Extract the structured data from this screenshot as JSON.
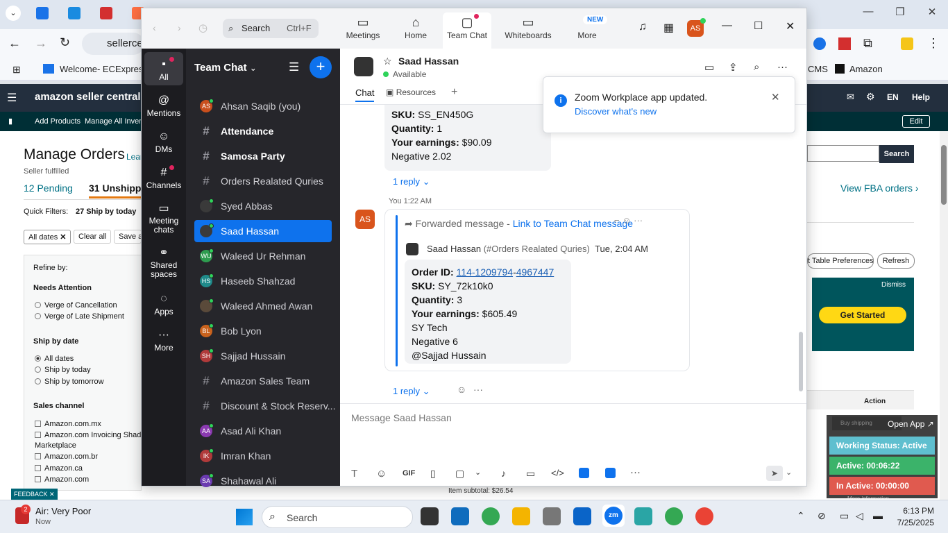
{
  "browser": {
    "tabs": [
      {
        "icon": "ec-icon"
      },
      {
        "icon": "doc-icon"
      },
      {
        "icon": "flag-icon"
      },
      {
        "icon": "swirl-icon"
      }
    ],
    "address": "sellerce",
    "bookmarks": [
      {
        "icon": "ec-icon",
        "label": "Welcome- ECExpres..."
      },
      {
        "label": "CMS"
      },
      {
        "icon": "amazon-icon",
        "label": "Amazon"
      }
    ]
  },
  "amazon": {
    "logo": "amazon seller central",
    "header_right": {
      "lang": "EN",
      "help": "Help"
    },
    "nav": {
      "add_products": "Add Products",
      "manage_inventory": "Manage All Invent",
      "edit": "Edit"
    },
    "page_title": "Manage Orders",
    "learn": "Lear",
    "seller_fulfilled": "Seller fulfilled",
    "pending": "12 Pending",
    "unshipped": "31 Unshipp",
    "quick_filters_label": "Quick Filters:",
    "quick_filter_value": "27 Ship by today",
    "all_dates": "All dates",
    "clear_all": "Clear all",
    "save": "Save a",
    "search_btn": "Search",
    "view_fba": "View FBA orders",
    "table_prefs": "t Table Preferences",
    "refresh": "Refresh",
    "refine_by": "Refine by:",
    "needs_attention": "Needs Attention",
    "attention_options": [
      "Verge of Cancellation",
      "Verge of Late Shipment"
    ],
    "ship_by_date": "Ship by date",
    "ship_options": [
      "All dates",
      "Ship by today",
      "Ship by tomorrow"
    ],
    "sales_channel": "Sales channel",
    "channels": [
      "Amazon.com.mx",
      "Amazon.com Invoicing Shado",
      "Marketplace",
      "Amazon.com.br",
      "Amazon.ca",
      "Amazon.com"
    ],
    "banner": {
      "dismiss": "Dismiss",
      "get_started": "Get Started"
    },
    "action_header": "Action",
    "item_subtotal": "Item subtotal: $26.54",
    "feedback": "FEEDBACK",
    "buy_shipping": "Buy shipping"
  },
  "tracker": {
    "open_app": "Open App ↗",
    "working_status": "Working Status: Active",
    "active": "Active: 00:06:22",
    "inactive": "In Active: 00:00:00",
    "more_info": "More information"
  },
  "zoom": {
    "search_label": "Search",
    "search_shortcut": "Ctrl+F",
    "tabs": [
      {
        "label": "Meetings",
        "icon": "video-icon"
      },
      {
        "label": "Home",
        "icon": "home-icon"
      },
      {
        "label": "Team Chat",
        "icon": "chat-icon"
      },
      {
        "label": "Whiteboards",
        "icon": "whiteboard-icon"
      },
      {
        "label": "More",
        "icon": "more-icon"
      }
    ],
    "new_badge": "NEW",
    "profile_initials": "AS",
    "rail": [
      {
        "label": "All",
        "icon": "chat-icon"
      },
      {
        "label": "Mentions",
        "icon": "at-icon"
      },
      {
        "label": "DMs",
        "icon": "people-icon"
      },
      {
        "label": "Channels",
        "icon": "hash-icon"
      },
      {
        "label": "Meeting chats",
        "icon": "calendar-icon"
      },
      {
        "label": "Shared spaces",
        "icon": "share-icon"
      },
      {
        "label": "Apps",
        "icon": "apps-icon"
      },
      {
        "label": "More",
        "icon": "more-icon"
      }
    ],
    "list_title": "Team Chat",
    "list": [
      {
        "type": "dm",
        "name": "Ahsan Saqib (you)",
        "initials": "AS",
        "color": "#c94f1d"
      },
      {
        "type": "channel",
        "name": "Attendance",
        "bold": true
      },
      {
        "type": "channel",
        "name": "Samosa Party",
        "bold": true
      },
      {
        "type": "channel",
        "name": "Orders Realated Quries"
      },
      {
        "type": "dm",
        "name": "Syed Abbas",
        "initials": "",
        "color": "#3a3a3a"
      },
      {
        "type": "dm",
        "name": "Saad Hassan",
        "initials": "",
        "color": "#3a3a3a",
        "selected": true
      },
      {
        "type": "dm",
        "name": "Waleed Ur Rehman",
        "initials": "WU",
        "color": "#2e9c4f"
      },
      {
        "type": "dm",
        "name": "Haseeb Shahzad",
        "initials": "HS",
        "color": "#1f8a8a"
      },
      {
        "type": "dm",
        "name": "Waleed Ahmed Awan",
        "initials": "",
        "color": "#5a4a3a"
      },
      {
        "type": "dm",
        "name": "Bob Lyon",
        "initials": "BL",
        "color": "#c9621d"
      },
      {
        "type": "dm",
        "name": "Sajjad Hussain",
        "initials": "SH",
        "color": "#b03a3a"
      },
      {
        "type": "channel",
        "name": "Amazon Sales Team"
      },
      {
        "type": "channel",
        "name": "Discount & Stock Reserv..."
      },
      {
        "type": "dm",
        "name": "Asad Ali Khan",
        "initials": "AA",
        "color": "#8a3ab0"
      },
      {
        "type": "dm",
        "name": "Imran Khan",
        "initials": "IK",
        "color": "#b03a3a"
      },
      {
        "type": "dm",
        "name": "Shahawal Ali",
        "initials": "SA",
        "color": "#6a3ab0"
      }
    ],
    "chat": {
      "name": "Saad Hassan",
      "status": "Available",
      "tabs": [
        "Chat",
        "Resources"
      ],
      "prev_message": {
        "sku": "SS_EN450G",
        "quantity": "1",
        "earnings": "$90.09",
        "extra": "Negative 2.02",
        "replies": "1 reply"
      },
      "msg_meta": "You 1:22 AM",
      "sender_initials": "AS",
      "forwarded_label": "Forwarded message",
      "forwarded_sep": "-",
      "forwarded_link": "Link to Team Chat message",
      "orig_sender": "Saad Hassan",
      "orig_channel": "(#Orders Realated Quries)",
      "orig_time": "Tue, 2:04 AM",
      "order": {
        "order_label": "Order ID:",
        "order_id_1": "114-1209794",
        "order_id_sep": "-",
        "order_id_2": "4967447",
        "sku_label": "SKU:",
        "sku": "SY_72k10k0",
        "quantity_label": "Quantity:",
        "quantity": "3",
        "earnings_label": "Your earnings:",
        "earnings": "$605.49",
        "line1": "SY Tech",
        "line2": "Negative 6",
        "line3": "@Sajjad Hussain"
      },
      "replies": "1 reply",
      "composer_placeholder": "Message Saad Hassan",
      "gif": "GIF"
    },
    "toast": {
      "title": "Zoom Workplace app updated.",
      "link": "Discover what's new"
    }
  },
  "taskbar": {
    "weather_title": "Air: Very Poor",
    "weather_sub": "Now",
    "weather_badge": "2",
    "search": "Search",
    "time": "6:13 PM",
    "date": "7/25/2025"
  }
}
